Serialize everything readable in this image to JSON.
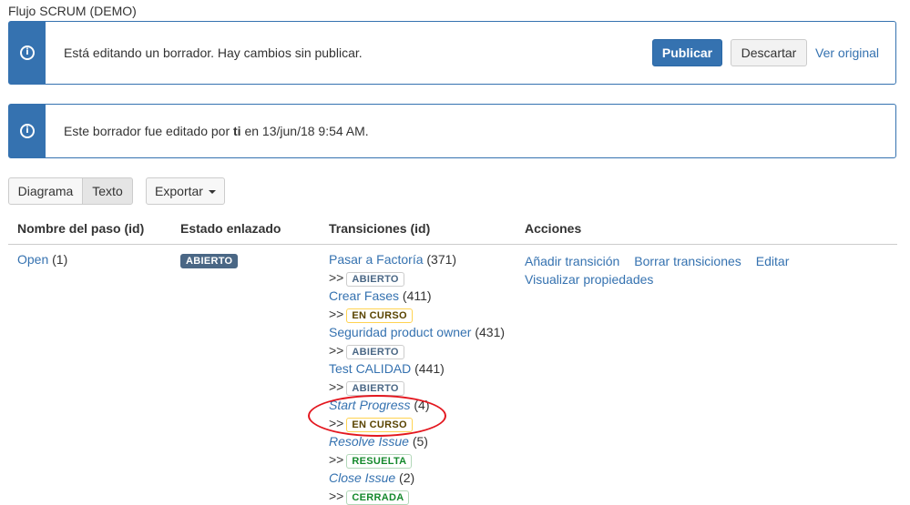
{
  "page": {
    "title": "Flujo SCRUM (DEMO)"
  },
  "draft_banner": {
    "icon": "info-icon",
    "message": "Está editando un borrador. Hay cambios sin publicar.",
    "publish_label": "Publicar",
    "discard_label": "Descartar",
    "view_original_label": "Ver original"
  },
  "edit_banner": {
    "icon": "info-icon",
    "prefix": "Este borrador fue editado por ",
    "editor": "ti",
    "suffix": " en 13/jun/18 9:54 AM."
  },
  "view_toggle": {
    "diagram_label": "Diagrama",
    "text_label": "Texto",
    "selected": "Texto"
  },
  "export": {
    "label": "Exportar",
    "icon": "caret-down-icon"
  },
  "table": {
    "headers": {
      "step": "Nombre del paso (id)",
      "status": "Estado enlazado",
      "transitions": "Transiciones (id)",
      "actions": "Acciones"
    },
    "row": {
      "step_name": "Open",
      "step_id": "(1)",
      "status": "ABIERTO",
      "transitions": [
        {
          "name": "Pasar a Factoría",
          "id": "(371)",
          "italic": false,
          "target": "ABIERTO",
          "target_color": "blue"
        },
        {
          "name": "Crear Fases",
          "id": "(411)",
          "italic": false,
          "target": "EN CURSO",
          "target_color": "yellow"
        },
        {
          "name": "Seguridad product owner",
          "id": "(431)",
          "italic": false,
          "target": "ABIERTO",
          "target_color": "blue"
        },
        {
          "name": "Test CALIDAD",
          "id": "(441)",
          "italic": false,
          "target": "ABIERTO",
          "target_color": "blue"
        },
        {
          "name": "Start Progress",
          "id": "(4)",
          "italic": true,
          "target": "EN CURSO",
          "target_color": "yellow"
        },
        {
          "name": "Resolve Issue",
          "id": "(5)",
          "italic": true,
          "target": "RESUELTA",
          "target_color": "green"
        },
        {
          "name": "Close Issue",
          "id": "(2)",
          "italic": true,
          "target": "CERRADA",
          "target_color": "green"
        }
      ],
      "arrow": ">>",
      "actions": {
        "add_transition": "Añadir transición",
        "delete_transitions": "Borrar transiciones",
        "edit": "Editar",
        "view_properties": "Visualizar propiedades"
      }
    }
  },
  "colors": {
    "accent": "#3572b0",
    "annotation": "#e3171f"
  }
}
